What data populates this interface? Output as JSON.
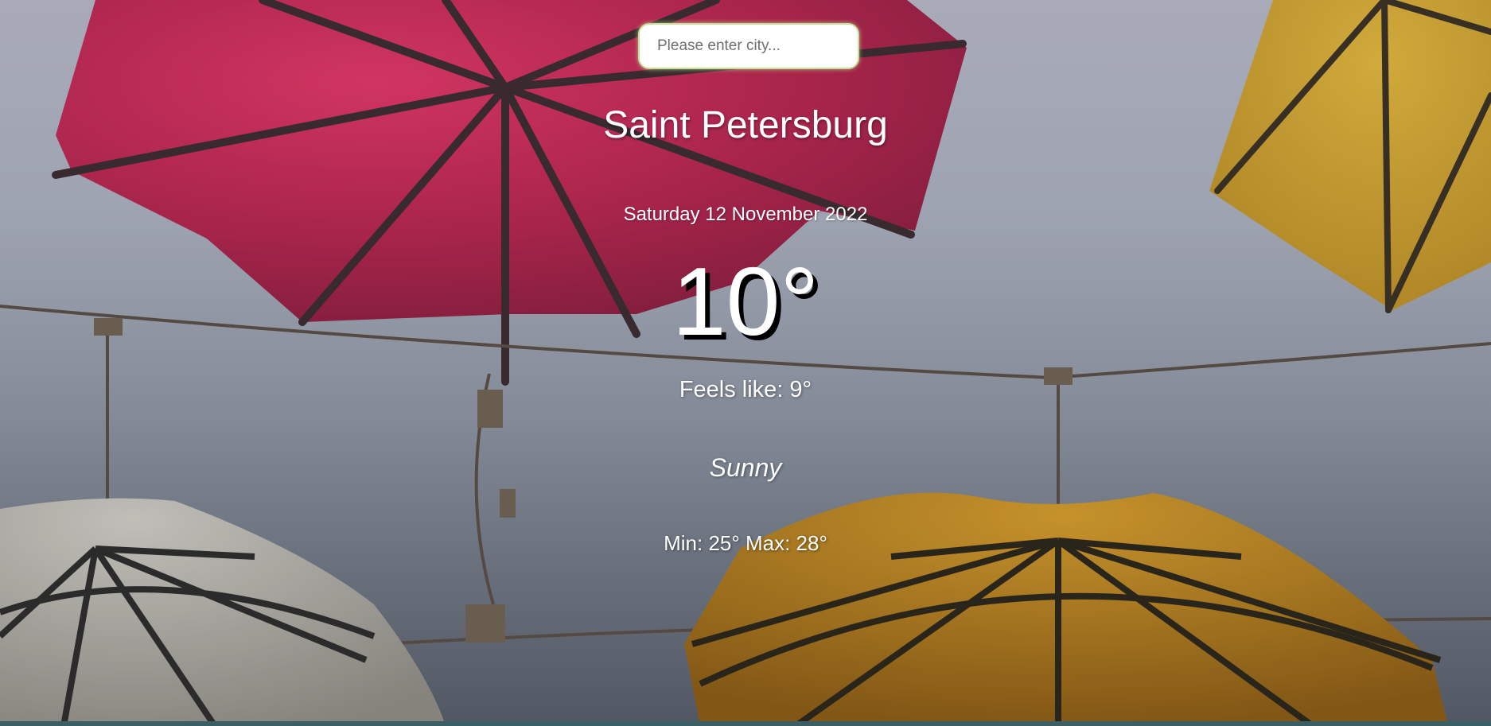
{
  "search": {
    "placeholder": "Please enter city...",
    "value": ""
  },
  "weather": {
    "city": "Saint Petersburg",
    "date": "Saturday 12 November 2022",
    "temperature": "10°",
    "feels_like": "Feels like: 9°",
    "condition": "Sunny",
    "min_max": "Min: 25° Max: 28°"
  },
  "background": {
    "description_icon": "umbrellas-photo",
    "colors": {
      "sky_top": "#b4b5c3",
      "sky_bottom": "#555b66",
      "umbrella_pink": "#b8264f",
      "umbrella_yellow": "#c79a2a",
      "umbrella_white": "#bfbcb4",
      "input_border": "#c7dd9a"
    }
  }
}
